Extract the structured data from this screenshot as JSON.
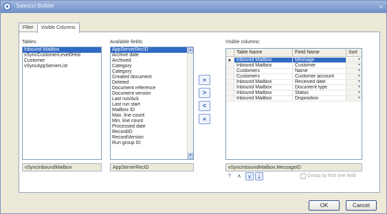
{
  "window": {
    "title": "Sales(s) Builder"
  },
  "tabs": [
    {
      "label": "Filter"
    },
    {
      "label": "Visible Columns"
    }
  ],
  "tables": {
    "label": "Tables:",
    "items": [
      "Inbound Mailbox",
      "vSyncCustomerLevel0Hist",
      "Customer",
      "vSyncAppServerList"
    ],
    "selected_index": 0,
    "status": "vSyncInboundMailbox"
  },
  "available_fields": {
    "label": "Available fields:",
    "items": [
      "AppServerRecID",
      "Archive date",
      "Archived",
      "Category",
      "Category",
      "Created document",
      "Deleted",
      "Document reference",
      "Document version",
      "Last run/Ack",
      "Last run start",
      "Mailbox ID",
      "Max. line count",
      "Min. line count",
      "Processed date",
      "RecordID",
      "RecordVersion",
      "Run group ID"
    ],
    "selected_index": 0,
    "status": "AppServerRecID"
  },
  "move_buttons": [
    {
      "symbol": "»",
      "name": "add-all-button"
    },
    {
      "symbol": ">",
      "name": "add-button"
    },
    {
      "symbol": "<",
      "name": "remove-button"
    },
    {
      "symbol": "«",
      "name": "remove-all-button"
    }
  ],
  "visible_columns": {
    "label": "Visible columns:",
    "headers": [
      "Table Name",
      "Field Name",
      "Sort"
    ],
    "rows": [
      {
        "table": "Inbound Mailbox",
        "field": "Message",
        "current": true
      },
      {
        "table": "Inbound Mailbox",
        "field": "Customer",
        "current": false
      },
      {
        "table": "Customers",
        "field": "Name",
        "current": false
      },
      {
        "table": "Customers",
        "field": "Customer account",
        "current": false
      },
      {
        "table": "Inbound Mailbox",
        "field": "Received date",
        "current": false
      },
      {
        "table": "Inbound Mailbox",
        "field": "Document type",
        "current": false
      },
      {
        "table": "Inbound Mailbox",
        "field": "Status",
        "current": false
      },
      {
        "table": "Inbound Mailbox",
        "field": "Disposition",
        "current": false
      }
    ],
    "status": "vSyncInboundMailbox.MessageID"
  },
  "order_buttons": [
    {
      "symbol": "⤒",
      "name": "move-to-top-icon"
    },
    {
      "symbol": "∧",
      "name": "move-up-icon"
    },
    {
      "symbol": "∨",
      "name": "move-down-icon"
    },
    {
      "symbol": "⤓",
      "name": "move-to-bottom-icon"
    }
  ],
  "group_option": {
    "label": "Group by first one field"
  },
  "buttons": {
    "ok": "OK",
    "cancel": "Cancel"
  }
}
